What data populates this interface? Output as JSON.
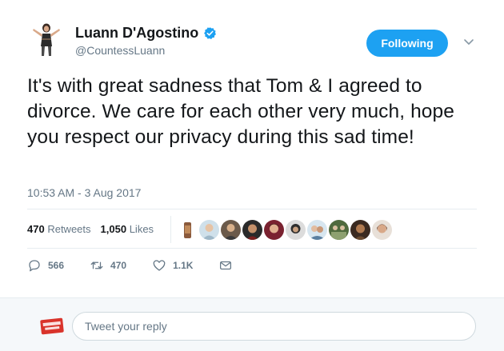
{
  "author": {
    "display_name": "Luann D'Agostino",
    "handle": "@CountessLuann",
    "verified": true
  },
  "follow_button": {
    "label": "Following"
  },
  "tweet": {
    "text": "It's with great sadness that Tom & I agreed to divorce. We care for each other very much, hope you respect our privacy during this sad time!",
    "timestamp": "10:53 AM - 3 Aug 2017"
  },
  "stats": {
    "retweets_count": "470",
    "retweets_label": "Retweets",
    "likes_count": "1,050",
    "likes_label": "Likes"
  },
  "liker_faces": [
    "face-1",
    "face-2",
    "face-3",
    "face-4",
    "face-5",
    "face-6",
    "face-7",
    "face-8",
    "face-9",
    "face-10"
  ],
  "actions": {
    "reply_count": "566",
    "retweet_count": "470",
    "like_count": "1.1K"
  },
  "reply_box": {
    "placeholder": "Tweet your reply"
  },
  "colors": {
    "accent": "#1da1f2",
    "muted": "#657786",
    "text": "#14171a",
    "divider": "#e6ecf0"
  }
}
